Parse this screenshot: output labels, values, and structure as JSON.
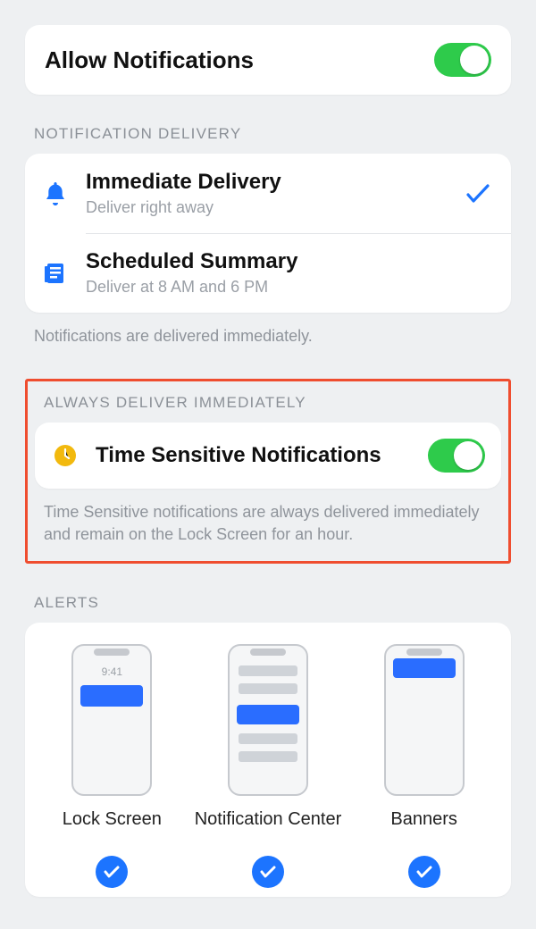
{
  "allow": {
    "label": "Allow Notifications",
    "on": true
  },
  "delivery": {
    "header": "NOTIFICATION DELIVERY",
    "items": [
      {
        "title": "Immediate Delivery",
        "sub": "Deliver right away",
        "selected": true
      },
      {
        "title": "Scheduled Summary",
        "sub": "Deliver at 8 AM and 6 PM",
        "selected": false
      }
    ],
    "footer": "Notifications are delivered immediately."
  },
  "time_sensitive": {
    "header": "ALWAYS DELIVER IMMEDIATELY",
    "title": "Time Sensitive Notifications",
    "on": true,
    "footer": "Time Sensitive notifications are always delivered immediately and remain on the Lock Screen for an hour."
  },
  "alerts": {
    "header": "ALERTS",
    "items": [
      {
        "label": "Lock Screen",
        "checked": true,
        "time": "9:41"
      },
      {
        "label": "Notification Center",
        "checked": true
      },
      {
        "label": "Banners",
        "checked": true
      }
    ]
  }
}
